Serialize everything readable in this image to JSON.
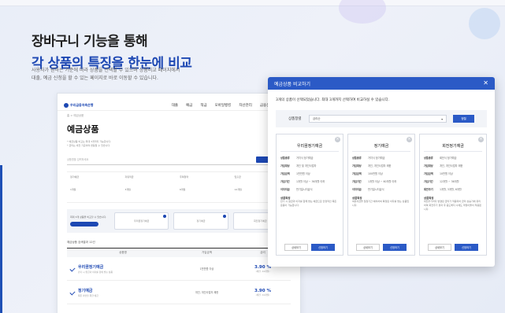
{
  "hero": {
    "line1": "장바구니 기능을 통해",
    "line2": "각 상품의 특징을 한눈에 비교",
    "desc1": "사용자가 원하는 기준에 따라 상품을 선택할 수 있으며 상품비교 페이지에서",
    "desc2": "대출, 예금 신청을 할 수 있는 페이지로 바로 이동할 수 있습니다."
  },
  "bg_page": {
    "topline": "고객센터 | 로그인",
    "logo_text": "우리금융저축은행",
    "menu": [
      "대출",
      "예금",
      "적금",
      "모바일뱅킹",
      "자산관리",
      "금융상품",
      "고객센터"
    ],
    "breadcrumb": "홈 > 예금상품",
    "title": "예금상품",
    "notes": [
      "* 예금상품 비교는 최대 3개까지 가능합니다.",
      "* 금리는 세전 기준이며 변동될 수 있습니다."
    ],
    "search_placeholder": "상품명을 입력하세요",
    "filters": [
      "정기예금",
      "자유적금",
      "주택청약",
      "입출금",
      "1개월",
      "3개월",
      "6개월",
      "12개월"
    ],
    "compare_lead": "최대 3개 상품을 비교할 수 있습니다.",
    "compare_slots": [
      "우리꿈정기예금",
      "정기예금",
      "회전정기예금"
    ],
    "list_head": "예금상품 검색결과 12건",
    "columns": [
      "상품명",
      "가입금액",
      "금리"
    ],
    "rows": [
      {
        "name": "우리꿈정기예금",
        "desc": "만기 시 원금과 이자를 함께 받는 상품",
        "amount": "1천만원 이상",
        "rate": "3.90 %",
        "rate_sub": "(세전, 12개월)"
      },
      {
        "name": "정기예금",
        "desc": "목돈 마련을 위한 예금",
        "amount": "개인, 개인사업자 제한",
        "rate": "3.90 %",
        "rate_sub": "(세전, 12개월)"
      }
    ]
  },
  "modal": {
    "title": "예금상품 비교하기",
    "close_icon": "close-icon",
    "desc": "3개의 상품이 선택되었습니다. 최대 3개까지 선택하여 비교하실 수 있습니다.",
    "sort_label": "상품정렬",
    "sort_value": "금리순",
    "sort_button": "정렬",
    "cards": [
      {
        "name": "우리꿈정기예금",
        "rows": [
          {
            "k": "상품종류",
            "v": "거치식 정기예금"
          },
          {
            "k": "가입대상",
            "v": "개인 및 개인사업자"
          },
          {
            "k": "가입금액",
            "v": "1천만원 이상"
          },
          {
            "k": "가입기간",
            "v": "1개월 이상 ~ 36개월 이하"
          },
          {
            "k": "이자지급",
            "v": "만기일시지급식"
          }
        ],
        "section": "상품특징",
        "section_text": "만기 시 원금과 이자를 함께 받는 예금으로 안정적인 목돈 운용이 가능합니다.",
        "btn_detail": "상세보기",
        "btn_apply": "신청하기"
      },
      {
        "name": "정기예금",
        "rows": [
          {
            "k": "상품종류",
            "v": "거치식 정기예금"
          },
          {
            "k": "가입대상",
            "v": "개인, 개인사업자 제한"
          },
          {
            "k": "가입금액",
            "v": "100만원 이상"
          },
          {
            "k": "가입기간",
            "v": "1개월 이상 ~ 60개월 이하"
          },
          {
            "k": "이자지급",
            "v": "만기일시지급식"
          }
        ],
        "section": "상품특징",
        "section_text": "여유자금을 일정기간 예치하여 확정된 이자를 받는 상품입니다.",
        "btn_detail": "상세보기",
        "btn_apply": "신청하기"
      },
      {
        "name": "회전정기예금",
        "rows": [
          {
            "k": "상품종류",
            "v": "회전식 정기예금"
          },
          {
            "k": "가입대상",
            "v": "개인, 개인사업자 제한"
          },
          {
            "k": "가입금액",
            "v": "10만원 이상"
          },
          {
            "k": "가입기간",
            "v": "12개월 ~ 36개월"
          },
          {
            "k": "회전주기",
            "v": "1개월, 3개월, 6개월"
          }
        ],
        "section": "상품특징",
        "section_text": "회전주기마다 변경된 금리가 적용되어 금리 상승기에 유리하며 회전주기 경과 후 중도해지 시에도 약정이율이 적용됩니다.",
        "btn_detail": "상세보기",
        "btn_apply": "신청하기"
      }
    ]
  }
}
